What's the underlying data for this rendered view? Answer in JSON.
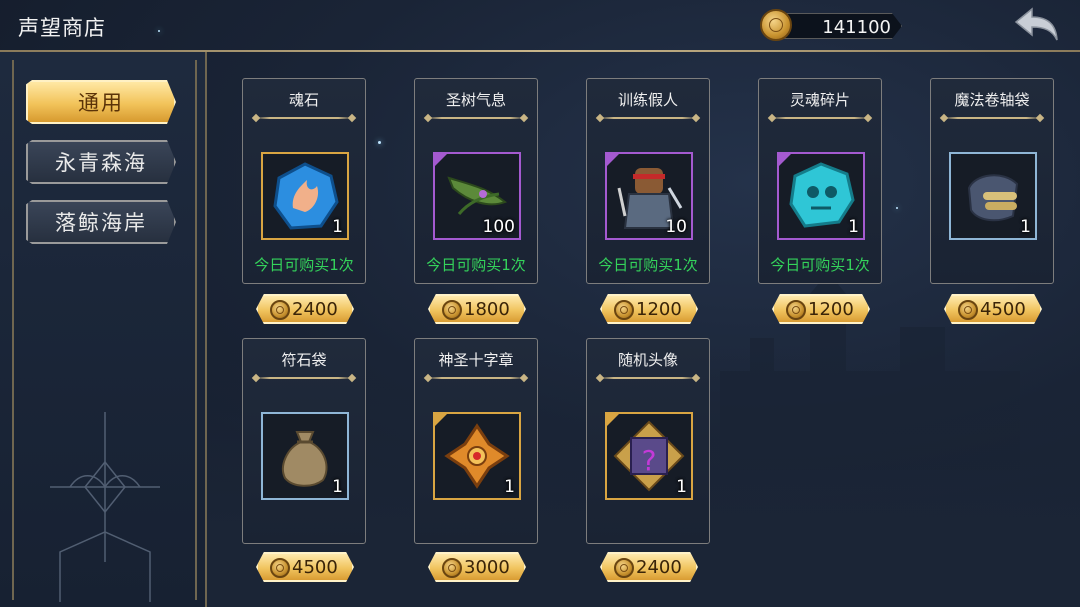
{
  "header": {
    "title": "声望商店",
    "currency_amount": "141100"
  },
  "sidebar": {
    "tabs": [
      {
        "label": "通用",
        "active": true
      },
      {
        "label": "永青森海",
        "active": false
      },
      {
        "label": "落鲸海岸",
        "active": false
      }
    ]
  },
  "shop": {
    "items": [
      {
        "name": "魂石",
        "quantity": "1",
        "limit": "今日可购买1次",
        "price": "2400",
        "icon": "soul-stone-icon",
        "frame": "gold"
      },
      {
        "name": "圣树气息",
        "quantity": "100",
        "limit": "今日可购买1次",
        "price": "1800",
        "icon": "leaf-icon",
        "frame": "purple"
      },
      {
        "name": "训练假人",
        "quantity": "10",
        "limit": "今日可购买1次",
        "price": "1200",
        "icon": "training-dummy-icon",
        "frame": "purple"
      },
      {
        "name": "灵魂碎片",
        "quantity": "1",
        "limit": "今日可购买1次",
        "price": "1200",
        "icon": "soul-shard-icon",
        "frame": "purple"
      },
      {
        "name": "魔法卷轴袋",
        "quantity": "1",
        "limit": "",
        "price": "4500",
        "icon": "scroll-bag-icon",
        "frame": "blue"
      },
      {
        "name": "符石袋",
        "quantity": "1",
        "limit": "",
        "price": "4500",
        "icon": "rune-bag-icon",
        "frame": "blue"
      },
      {
        "name": "神圣十字章",
        "quantity": "1",
        "limit": "",
        "price": "3000",
        "icon": "holy-cross-icon",
        "frame": "gold"
      },
      {
        "name": "随机头像",
        "quantity": "1",
        "limit": "",
        "price": "2400",
        "icon": "random-avatar-icon",
        "frame": "gold"
      }
    ]
  },
  "colors": {
    "accent_gold": "#f2c35a",
    "limit_green": "#34d35b",
    "frame_purple": "#a45ad0",
    "frame_blue": "#8fb6d6"
  }
}
